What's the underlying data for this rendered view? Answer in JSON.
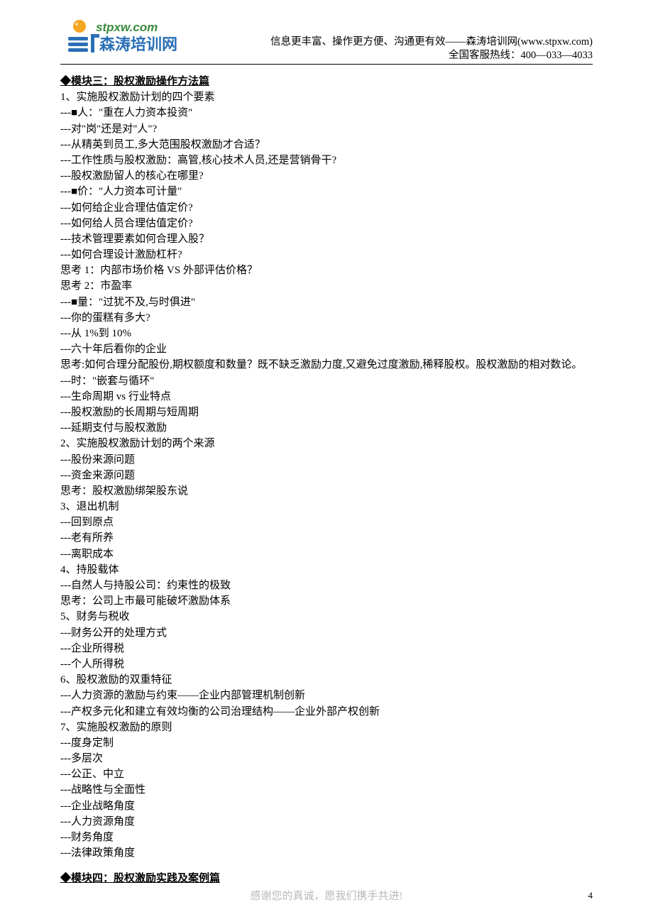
{
  "header": {
    "logo_url_text": "stpxw.com",
    "logo_name_text": "森涛培训网",
    "tagline": "信息更丰富、操作更方便、沟通更有效——森涛培训网(www.stpxw.com)",
    "hotline": "全国客服热线：400—033—4033"
  },
  "module3": {
    "title": "◆模块三：股权激励操作方法篇",
    "lines": [
      "1、实施股权激励计划的四个要素",
      "---■人：\"重在人力资本投资\"",
      "---对\"岗\"还是对\"人\"?",
      "---从精英到员工,多大范围股权激励才合适？",
      "---工作性质与股权激励：高管,核心技术人员,还是营销骨干?",
      "---股权激励留人的核心在哪里?",
      "---■价：\"人力资本可计量\"",
      "---如何给企业合理估值定价?",
      "---如何给人员合理估值定价?",
      "---技术管理要素如何合理入股？",
      "---如何合理设计激励杠杆?",
      "思考 1：内部市场价格 VS 外部评估价格？",
      "思考 2：市盈率",
      "---■量：\"过犹不及,与时俱进\"",
      "---你的蛋糕有多大?",
      "---从 1%到 10%",
      "---六十年后看你的企业",
      "思考:如何合理分配股份,期权额度和数量？既不缺乏激励力度,又避免过度激励,稀释股权。股权激励的相对数论。",
      "---时：\"嵌套与循环\"",
      "---生命周期 vs 行业特点",
      "---股权激励的长周期与短周期",
      "---延期支付与股权激励",
      "2、实施股权激励计划的两个来源",
      "---股份来源问题",
      "---资金来源问题",
      "思考：股权激励绑架股东说",
      "3、退出机制",
      "---回到原点",
      "---老有所养",
      "---离职成本",
      "4、持股载体",
      "---自然人与持股公司：约束性的极致",
      "思考：公司上市最可能破坏激励体系",
      "5、财务与税收",
      "---财务公开的处理方式",
      "---企业所得税",
      "---个人所得税",
      "6、股权激励的双重特征",
      "---人力资源的激励与约束——企业内部管理机制创新",
      "---产权多元化和建立有效均衡的公司治理结构——企业外部产权创新",
      "7、实施股权激励的原则",
      "---度身定制",
      "---多层次",
      "---公正、中立",
      "---战略性与全面性",
      "---企业战略角度",
      "---人力资源角度",
      "---财务角度",
      "---法律政策角度"
    ]
  },
  "module4": {
    "title": "◆模块四：股权激励实践及案例篇"
  },
  "footer": {
    "text": "感谢您的真诚，愿我们携手共进!",
    "page": "4"
  }
}
